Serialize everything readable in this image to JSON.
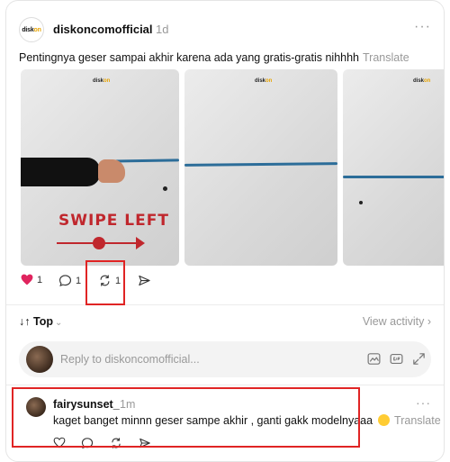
{
  "post": {
    "logo_text_a": "disk",
    "logo_text_b": "on",
    "username": "diskoncomofficial",
    "time": "1d",
    "more": "···",
    "caption": "Pentingnya geser sampai akhir karena ada yang gratis-gratis nihhhh",
    "translate": "Translate",
    "carousel": {
      "slide_1_text": "SWIPE LEFT"
    },
    "actions": {
      "like_count": "1",
      "comment_count": "1",
      "repost_count": "1"
    },
    "colors": {
      "like": "#e0245e",
      "highlight": "#e02424",
      "brand_accent": "#e8a400"
    }
  },
  "activity": {
    "sort_label": "Top",
    "sort_prefix": "↓↑",
    "sort_chevron": "⌄",
    "view_activity": "View activity ›"
  },
  "reply": {
    "placeholder": "Reply to diskoncomofficial..."
  },
  "comment": {
    "username": "fairysunset_",
    "time": "1m",
    "more": "···",
    "text": "kaget banget minnn geser sampe akhir , ganti gakk modelnyaaa",
    "translate": "Translate"
  }
}
